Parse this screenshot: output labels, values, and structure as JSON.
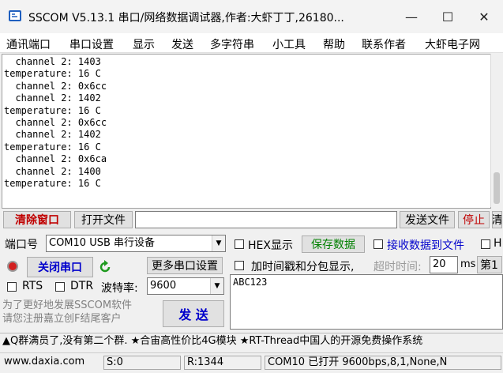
{
  "window": {
    "title": "SSCOM V5.13.1 串口/网络数据调试器,作者:大虾丁丁,26180...",
    "minimize_icon": "—",
    "maximize_icon": "☐",
    "close_icon": "✕"
  },
  "menu": {
    "items": [
      "通讯端口",
      "串口设置",
      "显示",
      "发送",
      "多字符串",
      "小工具",
      "帮助",
      "联系作者",
      "大虾电子网"
    ]
  },
  "terminal": {
    "lines": [
      "  channel 2: 1403",
      "temperature: 16 C",
      "  channel 2: 0x6cc",
      "  channel 2: 1402",
      "temperature: 16 C",
      "  channel 2: 0x6cc",
      "  channel 2: 1402",
      "temperature: 16 C",
      "  channel 2: 0x6ca",
      "  channel 2: 1400",
      "temperature: 16 C"
    ]
  },
  "toolbar": {
    "clear_window": "清除窗口",
    "open_file": "打开文件",
    "file_path": "",
    "send_file": "发送文件",
    "stop": "停止",
    "clear_extra": "清"
  },
  "port": {
    "label": "端口号",
    "value": "COM10 USB 串行设备",
    "close_port": "关闭串口",
    "more_settings": "更多串口设置",
    "rts": "RTS",
    "dtr": "DTR",
    "baud_label": "波特率:",
    "baud_value": "9600"
  },
  "options": {
    "hex_display": "HEX显示",
    "save_data": "保存数据",
    "receive_to_file": "接收数据到文件",
    "hex_send_partial": "H",
    "timestamp": "加时间戳和分包显示,",
    "timeout_label": "超时时间:",
    "timeout_value": "20",
    "timeout_unit": "ms",
    "page_label": "第1"
  },
  "send": {
    "input_text": "ABC123",
    "promo": "为了更好地发展SSCOM软件\n请您注册嘉立创F结尾客户",
    "send_button": "发  送"
  },
  "ticker": {
    "text": "▲Q群满员了,没有第二个群. ★合宙高性价比4G模块 ★RT-Thread中国人的开源免费操作系统"
  },
  "statusbar": {
    "website": "www.daxia.com",
    "sent": "S:0",
    "received": "R:1344",
    "port_status": "COM10 已打开  9600bps,8,1,None,N"
  },
  "colors": {
    "clear_button_text": "#c00000",
    "save_data_text": "#008000",
    "receive_file_text": "#0000cc",
    "stop_text": "#c00000",
    "promo_text": "#808080",
    "close_port_text": "#0000cc",
    "send_button_text": "#0000cc"
  }
}
